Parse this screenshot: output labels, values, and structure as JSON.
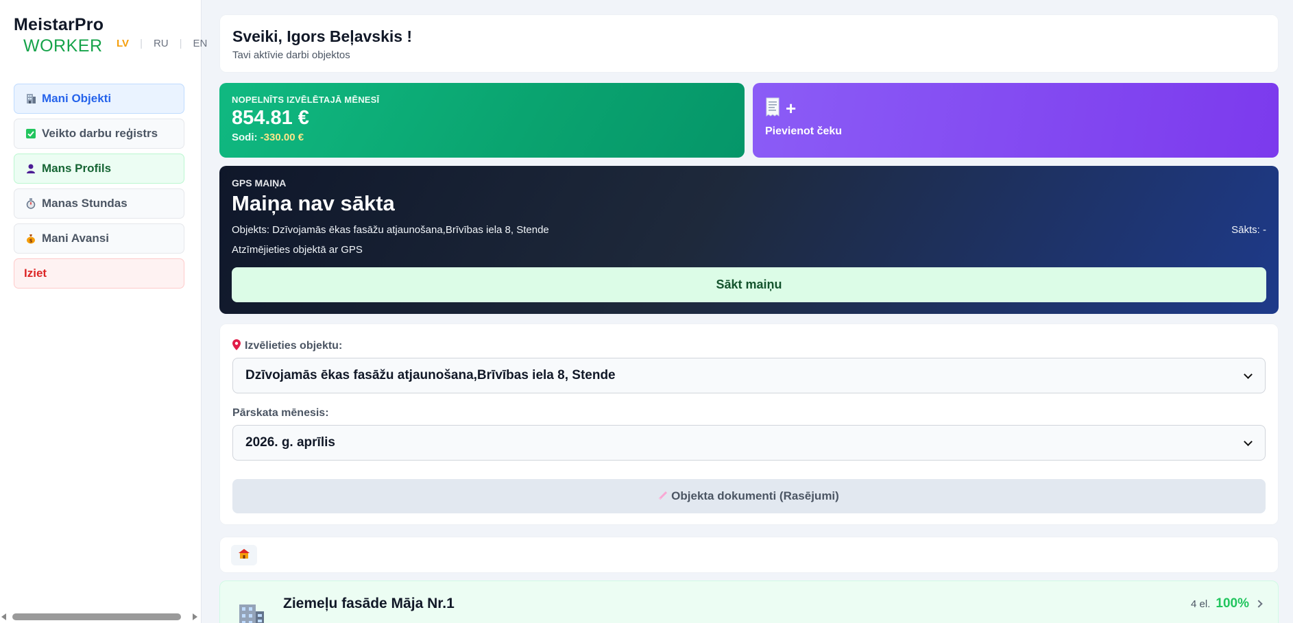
{
  "sidebar": {
    "brand_top": "MeistarPro",
    "brand_bottom": "WORKER",
    "languages": [
      "LV",
      "RU",
      "EN"
    ],
    "active_language": "LV",
    "items": [
      {
        "label": "Mani Objekti",
        "icon": "building-icon"
      },
      {
        "label": "Veikto darbu reģistrs",
        "icon": "check-box-icon"
      },
      {
        "label": "Mans Profils",
        "icon": "person-icon"
      },
      {
        "label": "Manas Stundas",
        "icon": "stopwatch-icon"
      },
      {
        "label": "Mani Avansi",
        "icon": "money-bag-icon"
      },
      {
        "label": "Iziet",
        "icon": ""
      }
    ]
  },
  "welcome": {
    "title": "Sveiki, Igors Beļavskis !",
    "subtitle": "Tavi aktīvie darbi objektos"
  },
  "earnings": {
    "label": "NOPELNĪTS IZVĒLĒTAJĀ MĒNESĪ",
    "amount": "854.81 €",
    "fines_label": "Sodi:",
    "fines_value": "-330.00 €"
  },
  "receipt": {
    "plus": "+",
    "label": "Pievienot čeku"
  },
  "gps": {
    "label": "GPS MAIŅA",
    "state": "Maiņa nav sākta",
    "object_line": "Objekts: Dzīvojamās ēkas fasāžu atjaunošana,Brīvības iela 8, Stende",
    "started_line": "Sākts: -",
    "hint": "Atzīmējieties objektā ar GPS",
    "start_button": "Sākt maiņu"
  },
  "filters": {
    "object_label": "Izvēlieties objektu:",
    "object_value": "Dzīvojamās ēkas fasāžu atjaunošana,Brīvības iela 8, Stende",
    "month_label": "Pārskata mēnesis:",
    "month_value": "2026. g. aprīlis",
    "docs_button": "Objekta dokumenti (Rasējumi)"
  },
  "section": {
    "title": "Ziemeļu fasāde Māja Nr.1",
    "count": "4 el.",
    "percent": "100%"
  },
  "colors": {
    "accent_green": "#10b981",
    "accent_purple": "#7c3aed",
    "gps_dark": "#0f172a",
    "active_blue": "#2563eb"
  }
}
